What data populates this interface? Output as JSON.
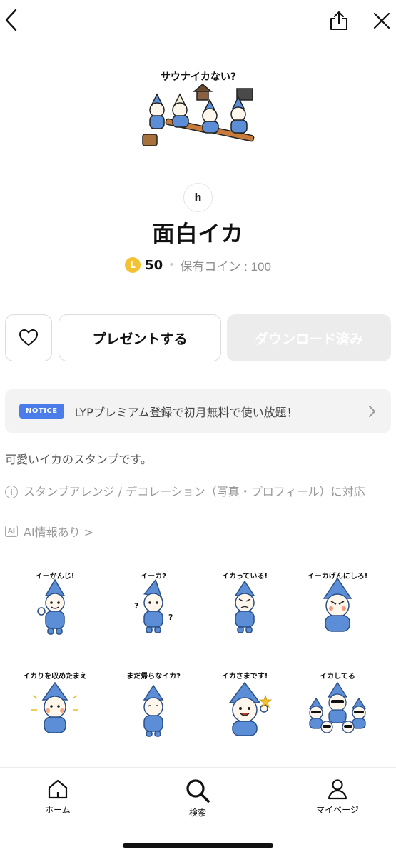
{
  "header": {
    "back_icon": "chevron-left-icon",
    "share_icon": "share-icon",
    "close_icon": "close-icon"
  },
  "hero": {
    "caption": "サウナイカない?"
  },
  "product": {
    "author_initial": "h",
    "title": "面白イカ",
    "coin_symbol": "L",
    "price": "50",
    "owned_coins": "保有コイン : 100"
  },
  "actions": {
    "favorite_icon": "heart-icon",
    "present_label": "プレゼントする",
    "download_label": "ダウンロード済み"
  },
  "notice": {
    "badge": "NOTICE",
    "text": "LYPプレミアム登録で初月無料で使い放題！"
  },
  "description": "可愛いイカのスタンプです。",
  "info": {
    "icon": "i",
    "text": "スタンプアレンジ / デコレーション（写真・プロフィール）に対応"
  },
  "ai": {
    "icon": "AI",
    "text": "AI情報あり >"
  },
  "stickers": [
    {
      "caption": "イーかんじ!"
    },
    {
      "caption": "イーカ?"
    },
    {
      "caption": "イカっている!"
    },
    {
      "caption": "イーカげんにしろ!"
    },
    {
      "caption": "イカりを収めたまえ"
    },
    {
      "caption": "まだ帰らなイカ?"
    },
    {
      "caption": "イカさまです!"
    },
    {
      "caption": "イカしてる"
    }
  ],
  "nav": {
    "home": "ホーム",
    "search": "検索",
    "mypage": "マイページ"
  },
  "colors": {
    "notice_badge": "#4a7dea",
    "coin": "#f2c230",
    "squid_blue": "#5b8ed6"
  }
}
